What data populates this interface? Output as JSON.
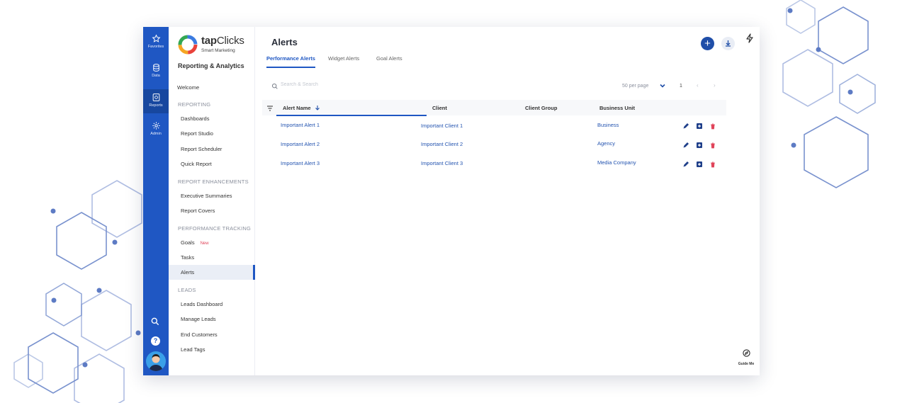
{
  "rail": {
    "items": [
      {
        "label": "Favorites",
        "icon": "star-icon"
      },
      {
        "label": "Data",
        "icon": "database-icon"
      },
      {
        "label": "Reports",
        "icon": "report-icon"
      },
      {
        "label": "Admin",
        "icon": "gear-icon"
      }
    ],
    "help": "?"
  },
  "brand": {
    "name_bold": "tap",
    "name_rest": "Clicks",
    "tagline": "Smart Marketing",
    "product": "Reporting & Analytics"
  },
  "menu": {
    "welcome": "Welcome",
    "sections": {
      "reporting": "REPORTING",
      "enhancements": "REPORT ENHANCEMENTS",
      "performance": "PERFORMANCE TRACKING",
      "leads": "LEADS"
    },
    "items": {
      "dashboards": "Dashboards",
      "report_studio": "Report Studio",
      "report_scheduler": "Report Scheduler",
      "quick_report": "Quick Report",
      "exec_summaries": "Executive Summaries",
      "report_covers": "Report Covers",
      "goals": "Goals",
      "goals_badge": "New",
      "tasks": "Tasks",
      "alerts": "Alerts",
      "leads_dashboard": "Leads Dashboard",
      "manage_leads": "Manage Leads",
      "end_customers": "End Customers",
      "lead_tags": "Lead Tags"
    }
  },
  "page": {
    "title": "Alerts",
    "tabs": [
      "Performance Alerts",
      "Widget Alerts",
      "Goal Alerts"
    ],
    "add_label": "+"
  },
  "toolbar": {
    "search_placeholder": "Search & Search",
    "per_page": "50 per page",
    "page": "1",
    "prev": "‹",
    "next": "›"
  },
  "table": {
    "columns": [
      "Alert Name",
      "Client",
      "Client Group",
      "Business Unit"
    ],
    "rows": [
      {
        "alert": "Important Alert 1",
        "client": "Important Client 1",
        "group": "",
        "unit": "Business"
      },
      {
        "alert": "Important Alert 2",
        "client": "Important Client 2",
        "group": "",
        "unit": "Agency"
      },
      {
        "alert": "Important Alert 3",
        "client": "Important Client 3",
        "group": "",
        "unit": "Media Company"
      }
    ]
  },
  "guide": {
    "label": "Guide Me"
  },
  "colors": {
    "primary": "#1f57c3",
    "link": "#2454b0",
    "danger": "#e0445a",
    "deco": "#5d7bc4"
  }
}
